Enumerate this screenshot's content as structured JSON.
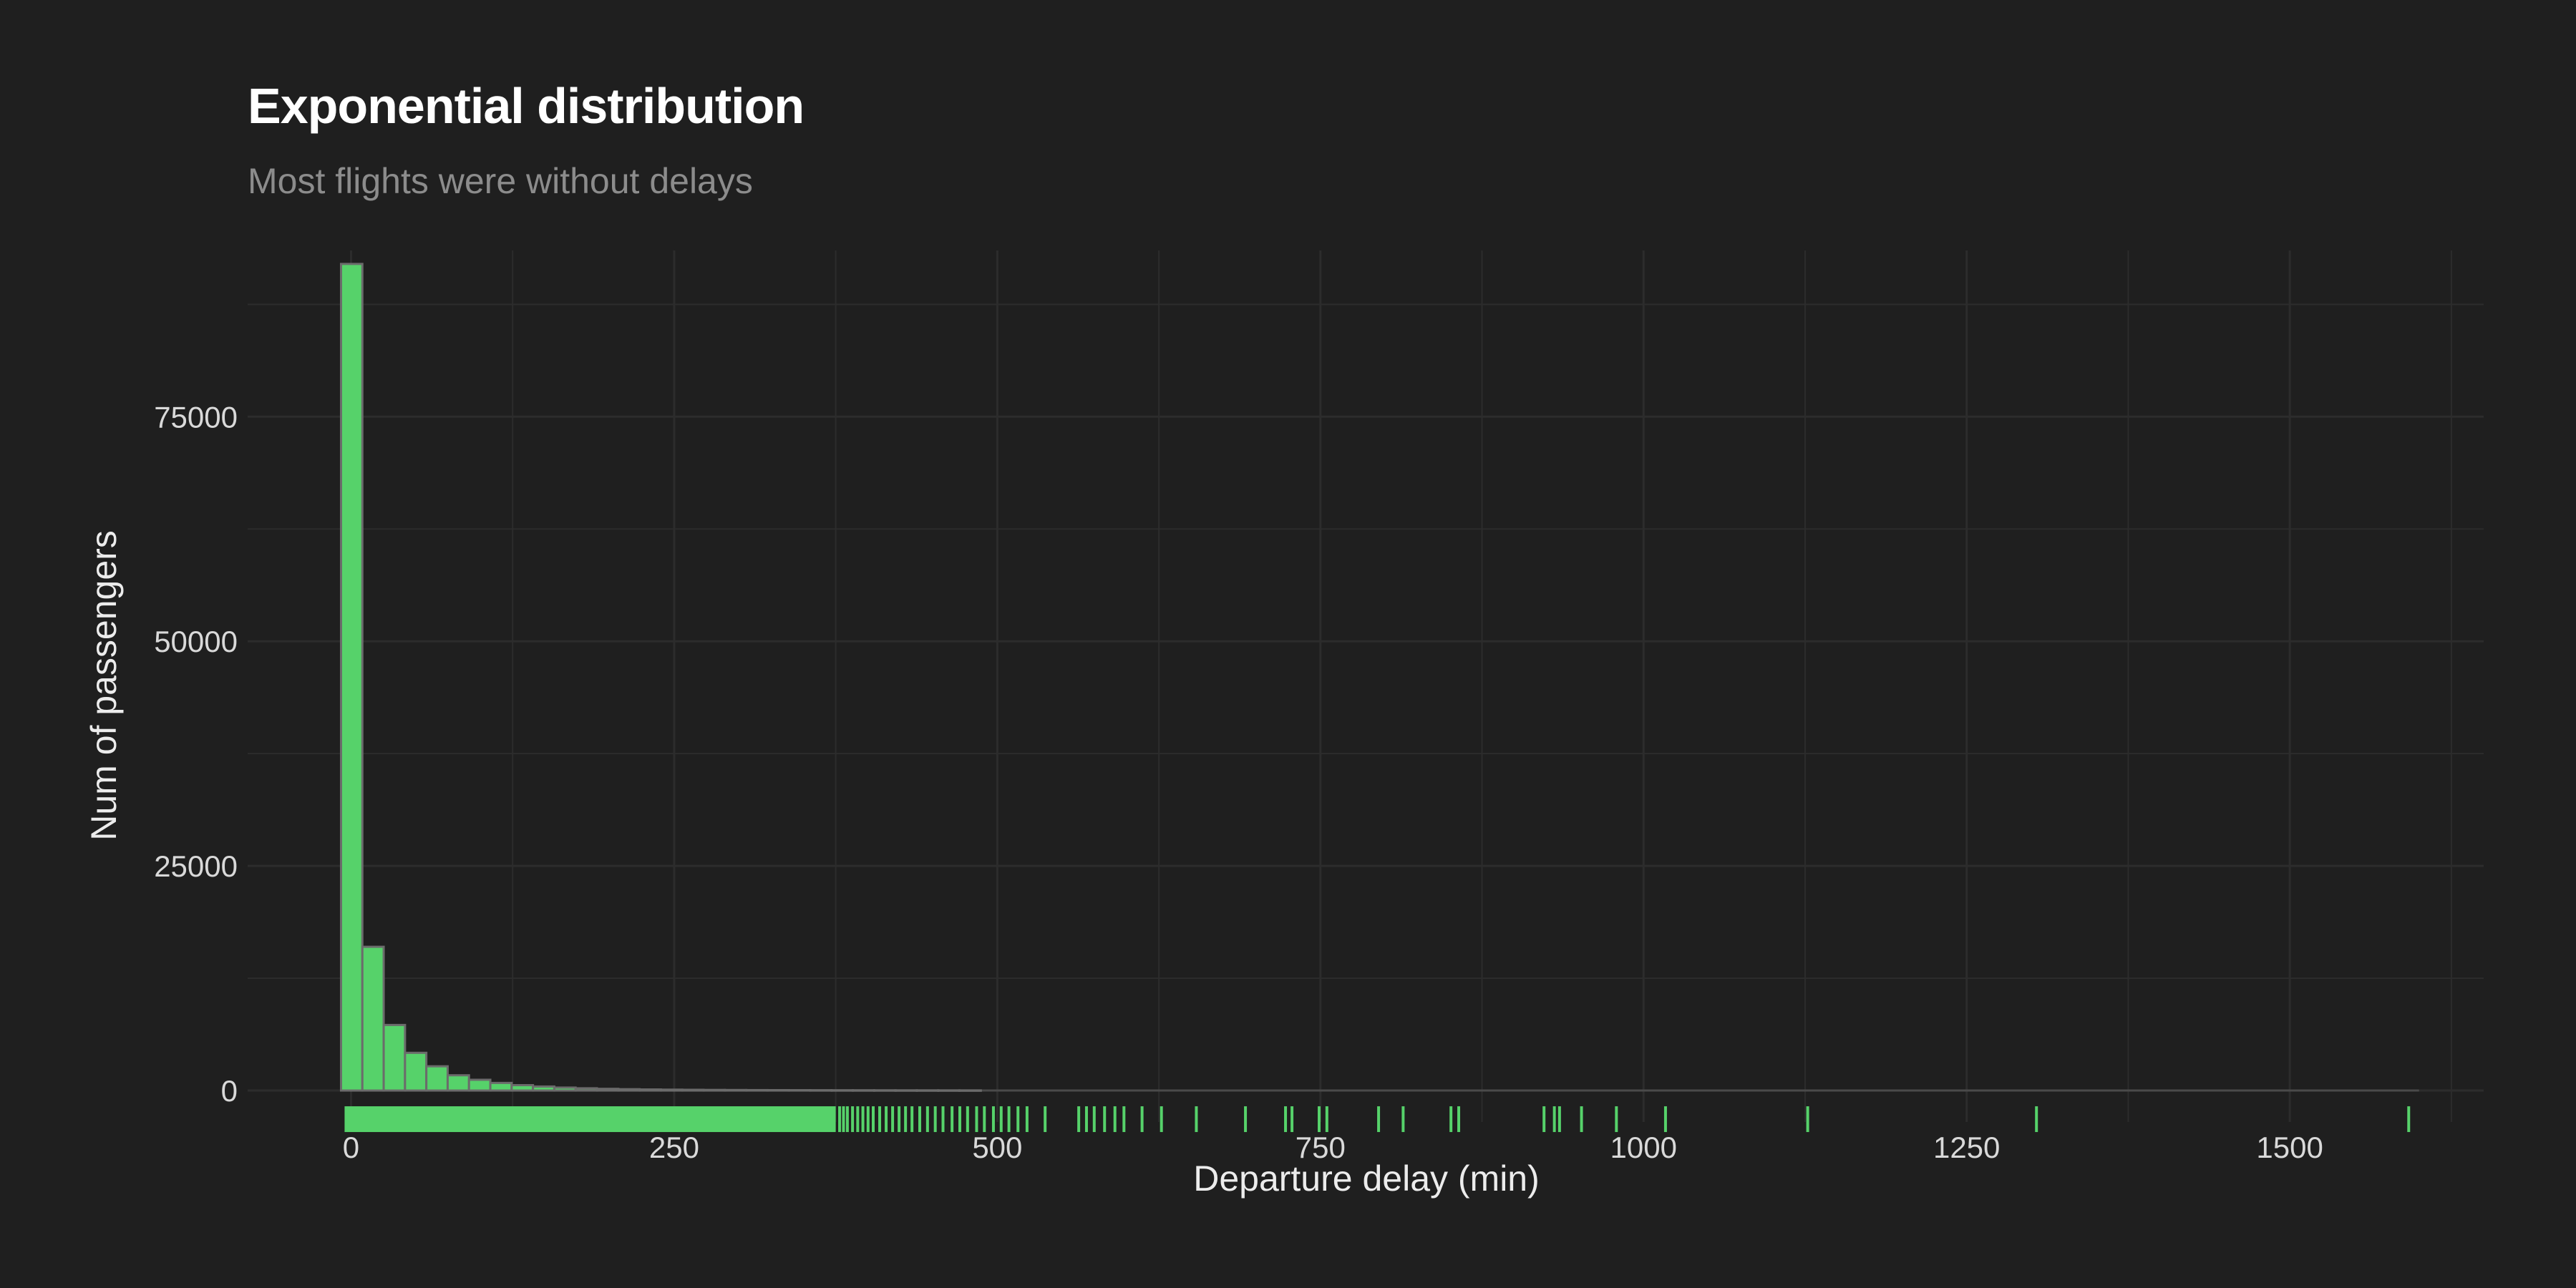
{
  "chart_data": {
    "type": "bar",
    "title": "Exponential distribution",
    "subtitle": "Most flights were without delays",
    "xlabel": "Departure delay (min)",
    "ylabel": "Num of passengers",
    "xlim": [
      -80,
      1650
    ],
    "ylim": [
      -3500,
      93500
    ],
    "x_ticks": [
      0,
      250,
      500,
      750,
      1000,
      1250,
      1500
    ],
    "x_tick_labels": [
      "0",
      "250",
      "500",
      "750",
      "1000",
      "1250",
      "1500"
    ],
    "y_ticks": [
      0,
      25000,
      50000,
      75000
    ],
    "y_tick_labels": [
      "0",
      "25000",
      "50000",
      "75000"
    ],
    "bin_width": 16.5,
    "bin_starts": [
      -7.75,
      8.75,
      25.25,
      41.75,
      58.25,
      74.75,
      91.25,
      107.75,
      124.25,
      140.75,
      157.25,
      173.75,
      190.25,
      206.75,
      223.25,
      239.75,
      256.25,
      272.75,
      289.25,
      305.75,
      322.25,
      338.75,
      355.25,
      371.75,
      388.25,
      404.75,
      421.25,
      437.75,
      454.25,
      470.75
    ],
    "values": [
      92000,
      16000,
      7300,
      4200,
      2700,
      1700,
      1200,
      850,
      600,
      450,
      330,
      250,
      190,
      150,
      120,
      100,
      85,
      70,
      60,
      50,
      45,
      40,
      35,
      30,
      28,
      25,
      22,
      20,
      18,
      15
    ],
    "grid": true,
    "legend": "none",
    "bar_color": "#56d26a",
    "bar_edge_color": "#6b6b6b",
    "background_color": "#1f1f1f",
    "grid_color": "#2c2c2c",
    "rug": {
      "dense_range": [
        -5,
        375
      ],
      "values": [
        378,
        381,
        384,
        388,
        392,
        396,
        400,
        404,
        409,
        414,
        419,
        424,
        429,
        434,
        440,
        446,
        452,
        458,
        465,
        471,
        477,
        484,
        490,
        497,
        503,
        509,
        516,
        523,
        537,
        563,
        569,
        575,
        583,
        591,
        598,
        612,
        627,
        654,
        692,
        723,
        728,
        749,
        755,
        795,
        814,
        851,
        857,
        923,
        931,
        935,
        952,
        979,
        1017,
        1127,
        1304,
        1592
      ]
    }
  }
}
